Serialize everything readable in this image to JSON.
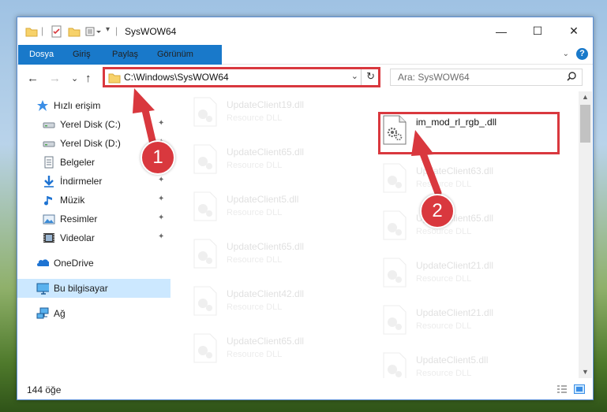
{
  "window": {
    "title": "SysWOW64",
    "controls": {
      "minimize": "—",
      "maximize": "☐",
      "close": "✕"
    }
  },
  "ribbon": {
    "tabs": [
      "Dosya",
      "Giriş",
      "Paylaş",
      "Görünüm"
    ],
    "help": "?",
    "expand": "⌄"
  },
  "nav": {
    "back": "←",
    "forward": "→",
    "recent": "⌄",
    "up": "↑",
    "address": "C:\\Windows\\SysWOW64",
    "address_dropdown": "⌄",
    "refresh": "↻",
    "search_placeholder": "Ara: SysWOW64"
  },
  "navpane": {
    "quick_access": "Hızlı erişim",
    "items": [
      {
        "label": "Yerel Disk (C:)",
        "icon": "drive-icon",
        "pinned": true
      },
      {
        "label": "Yerel Disk (D:)",
        "icon": "drive-icon",
        "pinned": true
      },
      {
        "label": "Belgeler",
        "icon": "documents-icon",
        "pinned": true
      },
      {
        "label": "İndirmeler",
        "icon": "downloads-icon",
        "pinned": true
      },
      {
        "label": "Müzik",
        "icon": "music-icon",
        "pinned": true
      },
      {
        "label": "Resimler",
        "icon": "pictures-icon",
        "pinned": true
      },
      {
        "label": "Videolar",
        "icon": "videos-icon",
        "pinned": true
      }
    ],
    "onedrive": "OneDrive",
    "this_pc": "Bu bilgisayar",
    "network": "Ağ",
    "pin_glyph": "📌"
  },
  "files": {
    "left_column": [
      {
        "name": "UpdateClient19.dll",
        "type": "Resource DLL"
      },
      {
        "name": "UpdateClient65.dll",
        "type": "Resource DLL"
      },
      {
        "name": "UpdateClient5.dll",
        "type": "Resource DLL"
      },
      {
        "name": "UpdateClient65.dll",
        "type": "Resource DLL"
      },
      {
        "name": "UpdateClient42.dll",
        "type": "Resource DLL"
      },
      {
        "name": "UpdateClient65.dll",
        "type": "Resource DLL"
      }
    ],
    "right_column": [
      {
        "name": "im_mod_rl_rgb_.dll",
        "type": ""
      },
      {
        "name": "UpdateClient63.dll",
        "type": "Resource DLL"
      },
      {
        "name": "UpdateClient65.dll",
        "type": "Resource DLL"
      },
      {
        "name": "UpdateClient21.dll",
        "type": "Resource DLL"
      },
      {
        "name": "UpdateClient21.dll",
        "type": "Resource DLL"
      },
      {
        "name": "UpdateClient5.dll",
        "type": "Resource DLL"
      }
    ]
  },
  "status": {
    "count": "144 öğe"
  },
  "annotations": {
    "badge1": "1",
    "badge2": "2"
  },
  "colors": {
    "accent": "#1979ca",
    "highlight": "#d9383e",
    "selection": "#cce8ff"
  }
}
